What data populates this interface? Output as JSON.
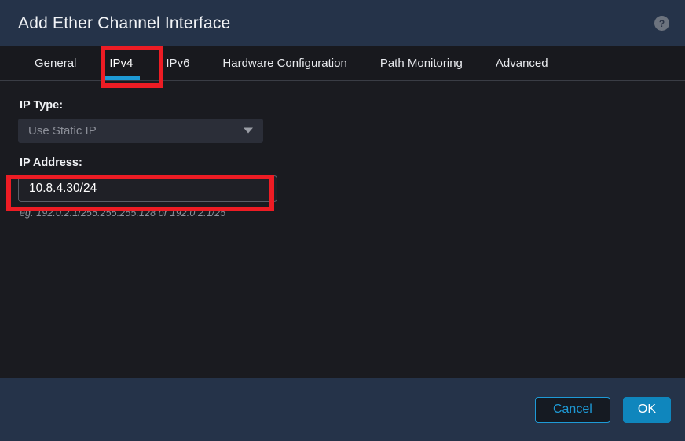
{
  "dialog": {
    "title": "Add Ether Channel Interface",
    "help_icon_glyph": "?",
    "help_icon_name": "help-question-icon"
  },
  "tabs": [
    {
      "label": "General",
      "active": false
    },
    {
      "label": "IPv4",
      "active": true
    },
    {
      "label": "IPv6",
      "active": false
    },
    {
      "label": "Hardware Configuration",
      "active": false
    },
    {
      "label": "Path Monitoring",
      "active": false
    },
    {
      "label": "Advanced",
      "active": false
    }
  ],
  "form": {
    "ip_type": {
      "label": "IP Type:",
      "selected": "Use Static IP",
      "arrow_icon": "chevron-down-icon"
    },
    "ip_address": {
      "label": "IP Address:",
      "value": "10.8.4.30/24",
      "placeholder": "",
      "hint": "eg. 192.0.2.1/255.255.255.128 or 192.0.2.1/25"
    }
  },
  "footer": {
    "cancel_label": "Cancel",
    "ok_label": "OK"
  },
  "colors": {
    "header_bg": "#253349",
    "tabbar_bg": "#18191e",
    "body_bg": "#1a1b20",
    "footer_bg": "#253349",
    "accent_blue": "#1e9ad6",
    "ok_button_blue": "#0f86bd",
    "annotation_red": "#ed1c24",
    "disabled_text": "#8c8f98",
    "hint_text": "#8e929b"
  }
}
